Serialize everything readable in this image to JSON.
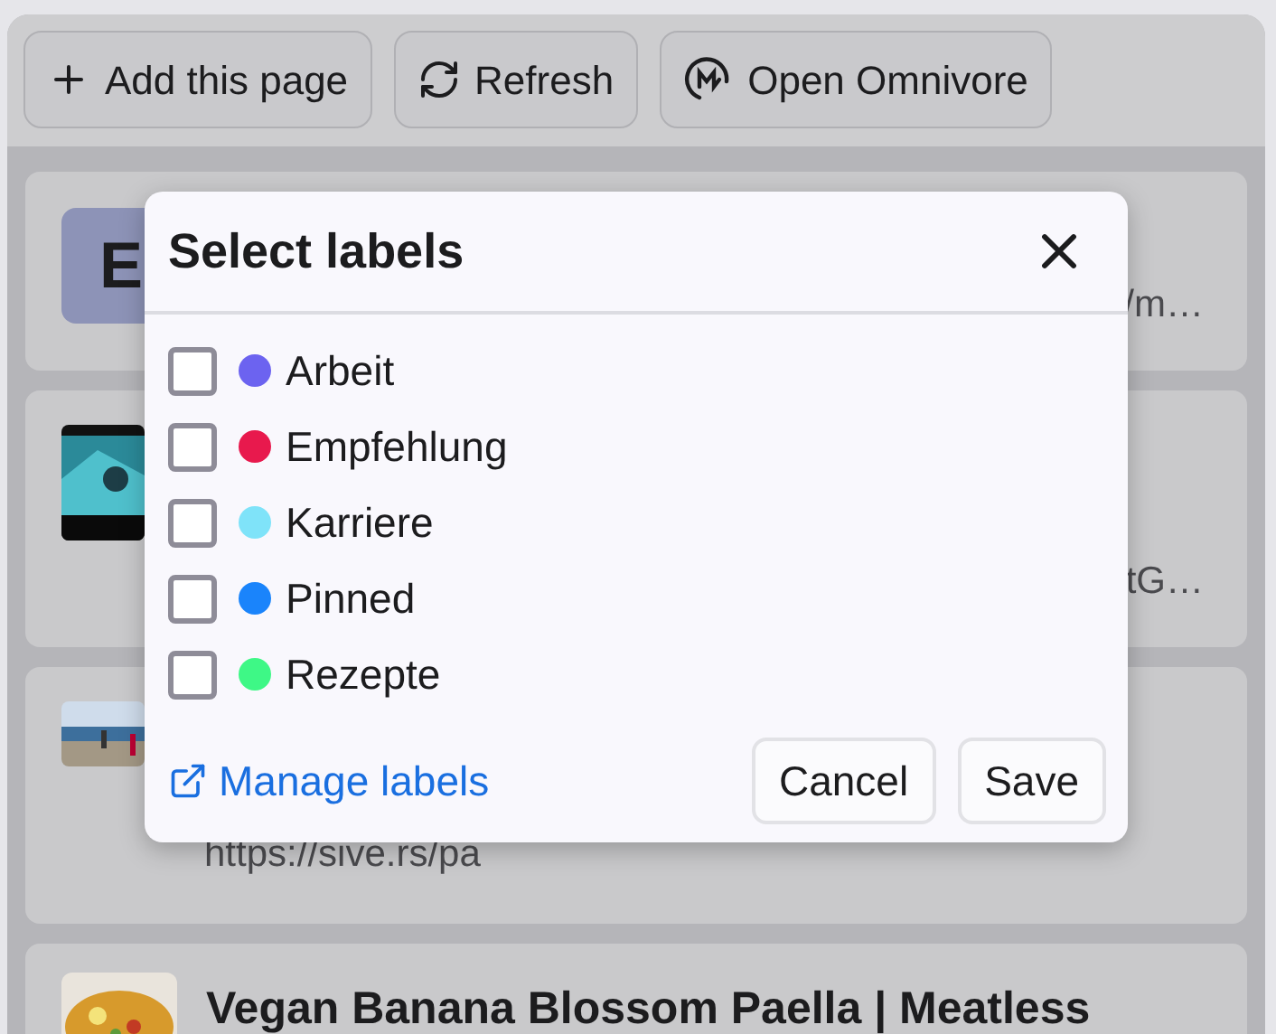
{
  "toolbar": {
    "buttons": [
      {
        "label": "Add this page",
        "kind": "add"
      },
      {
        "label": "Refresh",
        "kind": "refresh"
      },
      {
        "label": "Open Omnivore",
        "kind": "logo"
      }
    ]
  },
  "cards": [
    {
      "kind": "letter",
      "letter": "E",
      "fragments": [
        "/m…"
      ]
    },
    {
      "kind": "picture",
      "fragments": [
        "tG…"
      ]
    },
    {
      "kind": "picture",
      "fragments": [
        "https://sive.rs/pa"
      ]
    },
    {
      "kind": "picture",
      "title": "Vegan Banana Blossom Paella | Meatless"
    }
  ],
  "dialog": {
    "title": "Select labels",
    "labels": [
      {
        "name": "Arbeit",
        "color": "#6c63f0",
        "checked": false
      },
      {
        "name": "Empfehlung",
        "color": "#e8194d",
        "checked": false
      },
      {
        "name": "Karriere",
        "color": "#7fe3f9",
        "checked": false
      },
      {
        "name": "Pinned",
        "color": "#1a84fb",
        "checked": false
      },
      {
        "name": "Rezepte",
        "color": "#3ef886",
        "checked": false
      }
    ],
    "manage_link": "Manage labels",
    "buttons": [
      "Cancel",
      "Save"
    ]
  }
}
